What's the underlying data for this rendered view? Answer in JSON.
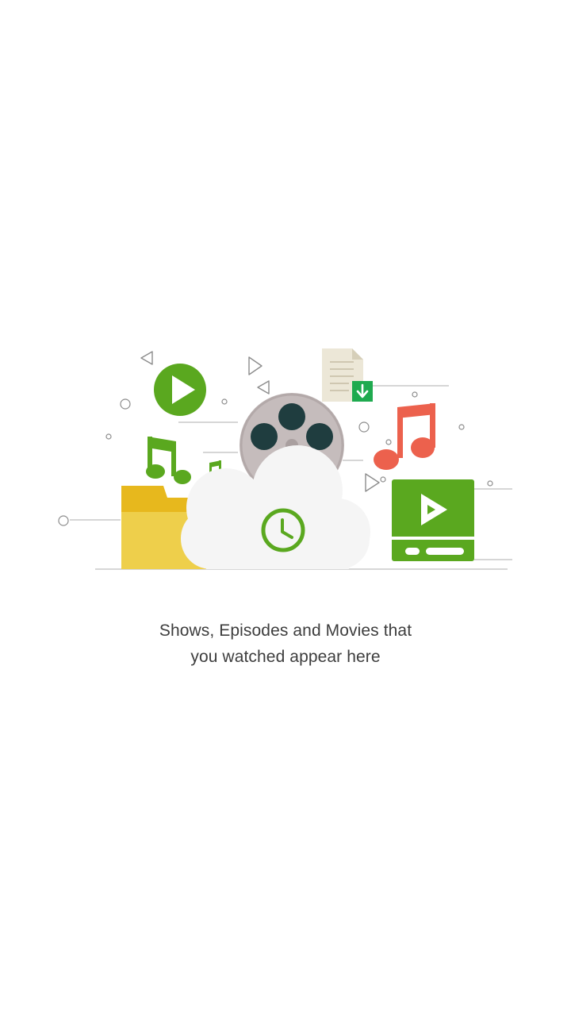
{
  "empty_state": {
    "message_line1": "Shows, Episodes and Movies that",
    "message_line2": "you watched appear here",
    "illustration": {
      "icons": [
        "play-icon",
        "film-reel-icon",
        "document-download-icon",
        "music-note-icon",
        "folder-icon",
        "cloud-icon",
        "clock-icon",
        "video-player-icon"
      ],
      "colors": {
        "green": "#5aa81f",
        "red_note": "#ec614d",
        "folder_yellow": "#eecf4b",
        "folder_tab": "#e7b81d",
        "reel_gray": "#c5bcbc",
        "reel_holes": "#1f3d3f",
        "cloud": "#f5f5f5",
        "line_gray": "#bdbdbd",
        "download_green": "#1faa4f"
      }
    }
  }
}
